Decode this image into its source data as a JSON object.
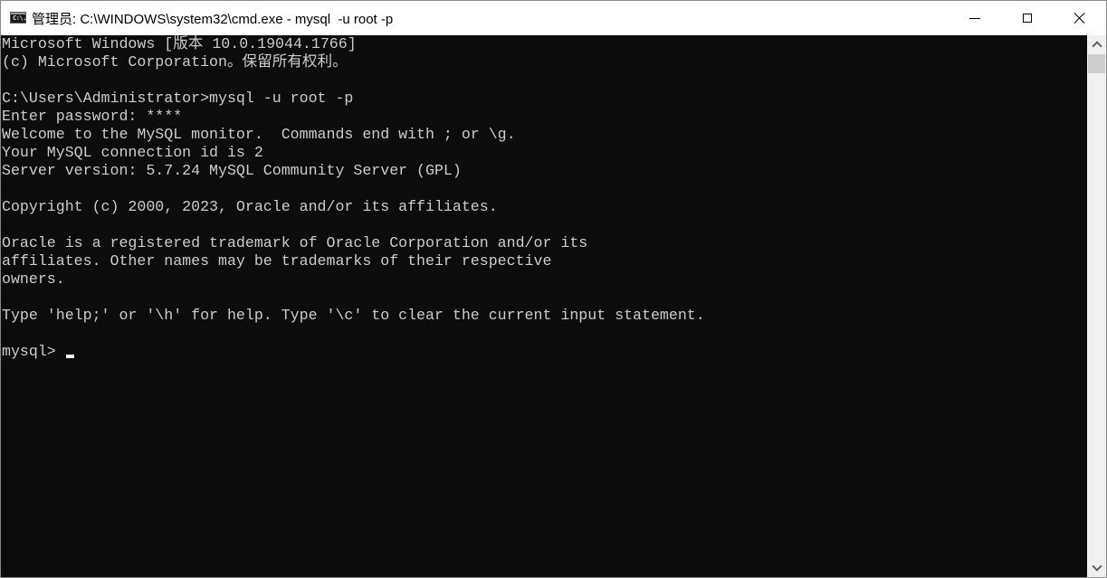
{
  "window": {
    "title": "管理员: C:\\WINDOWS\\system32\\cmd.exe - mysql  -u root -p",
    "app_icon_label": "C:\\.",
    "controls": {
      "minimize": "minimize",
      "maximize": "maximize",
      "close": "close"
    }
  },
  "console": {
    "colors": {
      "background": "#0c0c0c",
      "foreground": "#cccccc"
    },
    "lines": [
      "Microsoft Windows [版本 10.0.19044.1766]",
      "(c) Microsoft Corporation。保留所有权利。",
      "",
      "C:\\Users\\Administrator>mysql -u root -p",
      "Enter password: ****",
      "Welcome to the MySQL monitor.  Commands end with ; or \\g.",
      "Your MySQL connection id is 2",
      "Server version: 5.7.24 MySQL Community Server (GPL)",
      "",
      "Copyright (c) 2000, 2023, Oracle and/or its affiliates.",
      "",
      "Oracle is a registered trademark of Oracle Corporation and/or its",
      "affiliates. Other names may be trademarks of their respective",
      "owners.",
      "",
      "Type 'help;' or '\\h' for help. Type '\\c' to clear the current input statement.",
      ""
    ],
    "prompt": "mysql> ",
    "input_value": ""
  }
}
